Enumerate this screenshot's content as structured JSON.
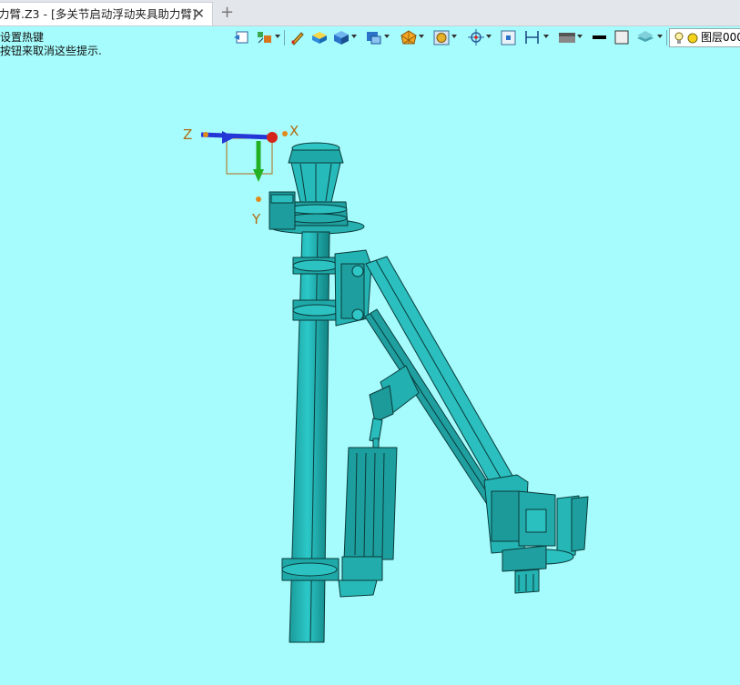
{
  "tab": {
    "title": "力臂.Z3 - [多关节启动浮动夹具助力臂]",
    "close_glyph": "✕",
    "new_tab_glyph": "+"
  },
  "hints": {
    "line1": "设置热键",
    "line2": "按钮来取消这些提示."
  },
  "toolbar": {
    "icons": [
      "undo-view-icon",
      "render-mode-icon",
      "sketch-pen-icon",
      "shade-box-icon",
      "cube-view-icon",
      "section-view-icon",
      "face-style-icon",
      "hexagon-part-icon",
      "lamp-icon",
      "center-icon",
      "frame-icon",
      "dimension-icon",
      "display-mode-icon",
      "line-color-icon",
      "fill-color-icon",
      "layer-stack-icon"
    ],
    "layer": {
      "label": "图层000"
    }
  },
  "triad": {
    "x_label": "X",
    "y_label": "Y",
    "z_label": "Z"
  },
  "colors": {
    "background": "#a6fcfc",
    "model_fill": "#26b7b7",
    "model_dark": "#168e8e",
    "outline": "#0b3a3a",
    "x_axis": "#d4241c",
    "y_axis": "#23b123",
    "z_axis": "#2536d6"
  }
}
